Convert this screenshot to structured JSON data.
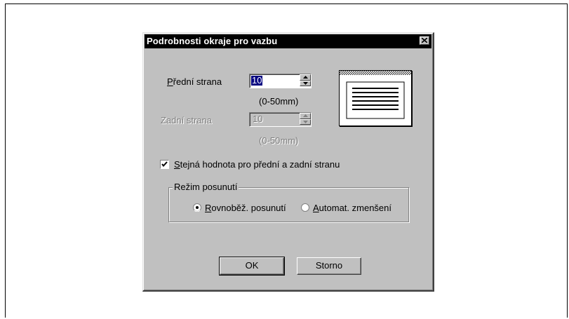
{
  "dialog": {
    "title": "Podrobnosti okraje pro vazbu",
    "close_label": "×"
  },
  "front": {
    "label_key": "P",
    "label_rest": "řední strana",
    "value": "10",
    "range": "(0-50mm)",
    "enabled": true
  },
  "back": {
    "label": "Zadní strana",
    "value": "10",
    "range": "(0-50mm)",
    "enabled": false
  },
  "same_value": {
    "label_key": "S",
    "label_rest": "tejná hodnota pro přední a zadní stranu",
    "checked": true
  },
  "shift_mode": {
    "legend": "Režim posunutí",
    "options": [
      {
        "key": "R",
        "rest": "ovnoběž. posunutí",
        "selected": true
      },
      {
        "key": "A",
        "rest": "utomat. zmenšení",
        "selected": false
      }
    ]
  },
  "buttons": {
    "ok": "OK",
    "cancel": "Storno"
  },
  "icons": [
    "close-icon",
    "spin-up-icon",
    "spin-down-icon",
    "check-icon",
    "radio-dot-icon",
    "page-preview-icon"
  ]
}
